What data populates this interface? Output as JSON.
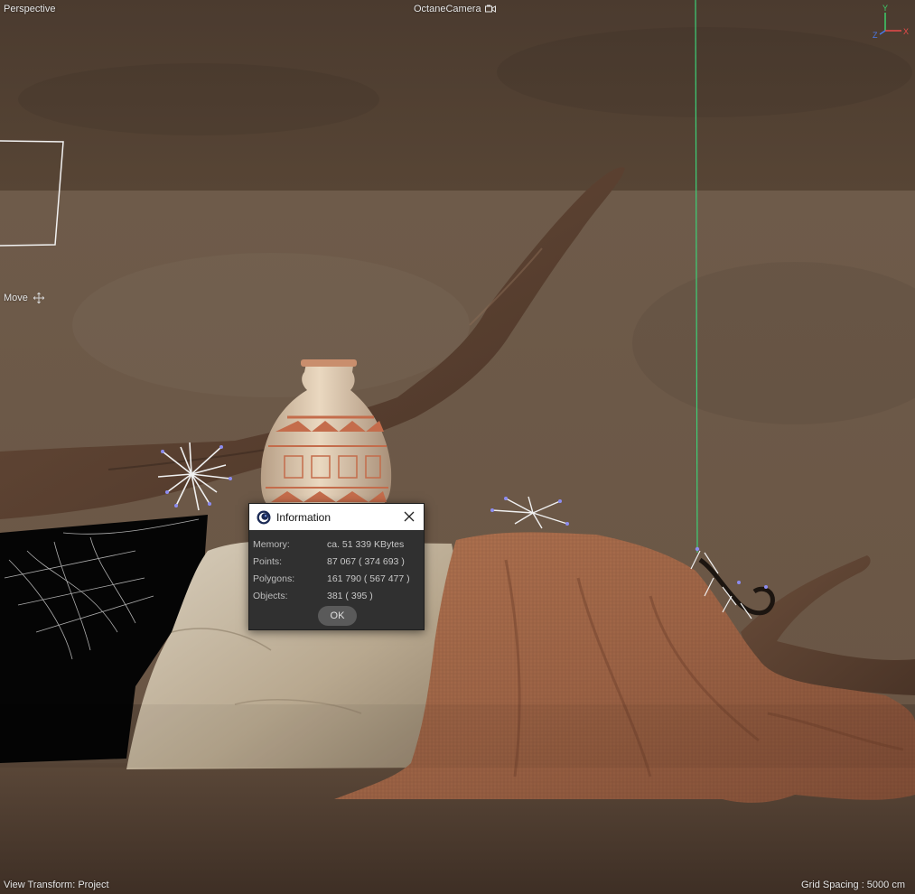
{
  "viewport": {
    "view_name": "Perspective",
    "camera_name": "OctaneCamera",
    "tool_name": "Move",
    "view_transform": "View Transform: Project",
    "grid_spacing": "Grid Spacing : 5000 cm",
    "axis_labels": {
      "y": "Y",
      "z": "Z",
      "x": "X"
    },
    "axis_colors": {
      "y": "#3ccf6a",
      "z": "#4a78e8",
      "x": "#e84a4a"
    }
  },
  "dialog": {
    "title": "Information",
    "app_icon": "cinema4d-logo-icon",
    "close_icon": "close-icon",
    "rows": [
      {
        "key": "Memory:",
        "value": "ca. 51 339 KBytes"
      },
      {
        "key": "Points:",
        "value": "87 067 ( 374 693 )"
      },
      {
        "key": "Polygons:",
        "value": "161 790 ( 567 477 )"
      },
      {
        "key": "Objects:",
        "value": "381 ( 395 )"
      }
    ],
    "ok_label": "OK"
  }
}
